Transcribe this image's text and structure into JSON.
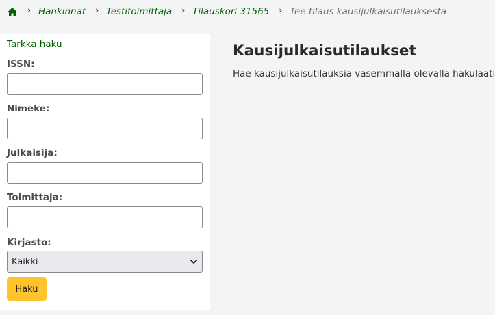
{
  "breadcrumb": {
    "home_icon": "home-icon",
    "items": [
      "Hankinnat",
      "Testitoimittaja",
      "Tilauskori 31565"
    ],
    "current": "Tee tilaus kausijulkaisutilauksesta"
  },
  "sidebar": {
    "advanced_link": "Tarkka haku",
    "issn_label": "ISSN:",
    "issn_value": "",
    "title_label": "Nimeke:",
    "title_value": "",
    "publisher_label": "Julkaisija:",
    "publisher_value": "",
    "vendor_label": "Toimittaja:",
    "vendor_value": "",
    "library_label": "Kirjasto:",
    "library_selected": "Kaikki",
    "search_button": "Haku"
  },
  "main": {
    "title": "Kausijulkaisutilaukset",
    "description": "Hae kausijulkaisutilauksia vasemmalla olevalla hakulaatikolla."
  },
  "colors": {
    "link": "#006100",
    "button": "#ffc32b",
    "background": "#f3f4f4"
  }
}
